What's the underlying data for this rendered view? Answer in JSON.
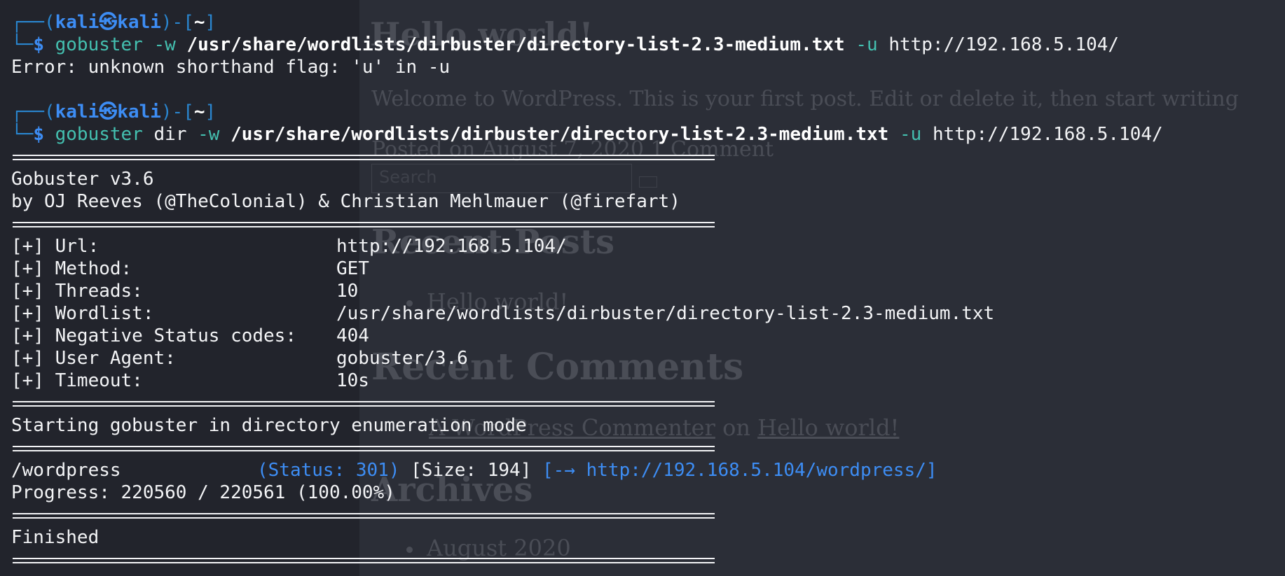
{
  "background_page": {
    "title": "Hello world!",
    "welcome_text": "Welcome to WordPress. This is your first post. Edit or delete it, then start writing",
    "post_meta": "Posted on August 7, 2020 1 Comment",
    "search_placeholder": "Search",
    "recent_posts_heading": "Recent Posts",
    "recent_posts_item": "Hello world!",
    "recent_comments_heading": "Recent Comments",
    "comment_author": "A WordPress Commenter",
    "comment_on": "on",
    "comment_post": "Hello world!",
    "archives_heading": "Archives",
    "archives_item": "August 2020"
  },
  "terminal": {
    "prompt1": {
      "frame_open": "┌──(",
      "user": "kali",
      "at_icon": "㉿",
      "host": "kali",
      "frame_mid": ")-[",
      "dir": "~",
      "frame_close": "]",
      "prefix2": "└─",
      "dollar": "$",
      "cmd": "gobuster",
      "flag_w": "-w",
      "wordlist": "/usr/share/wordlists/dirbuster/directory-list-2.3-medium.txt",
      "flag_u": "-u",
      "url": "http://192.168.5.104/"
    },
    "error_line": "Error: unknown shorthand flag: 'u' in -u",
    "prompt2": {
      "frame_open": "┌──(",
      "user": "kali",
      "at_icon": "㉿",
      "host": "kali",
      "frame_mid": ")-[",
      "dir": "~",
      "frame_close": "]",
      "prefix2": "└─",
      "dollar": "$",
      "cmd": "gobuster",
      "subcmd": "dir",
      "flag_w": "-w",
      "wordlist": "/usr/share/wordlists/dirbuster/directory-list-2.3-medium.txt",
      "flag_u": "-u",
      "url": "http://192.168.5.104/"
    },
    "banner_version": "Gobuster v3.6",
    "banner_authors": "by OJ Reeves (@TheColonial) & Christian Mehlmauer (@firefart)",
    "config": [
      {
        "key": "[+] Url:",
        "value": "http://192.168.5.104/"
      },
      {
        "key": "[+] Method:",
        "value": "GET"
      },
      {
        "key": "[+] Threads:",
        "value": "10"
      },
      {
        "key": "[+] Wordlist:",
        "value": "/usr/share/wordlists/dirbuster/directory-list-2.3-medium.txt"
      },
      {
        "key": "[+] Negative Status codes:",
        "value": "404"
      },
      {
        "key": "[+] User Agent:",
        "value": "gobuster/3.6"
      },
      {
        "key": "[+] Timeout:",
        "value": "10s"
      }
    ],
    "starting_line": "Starting gobuster in directory enumeration mode",
    "result": {
      "path": "/wordpress",
      "status": "(Status: 301)",
      "size": "[Size: 194]",
      "redirect": "[-→ http://192.168.5.104/wordpress/]"
    },
    "progress_line": "Progress: 220560 / 220561 (100.00%)",
    "finished_line": "Finished"
  },
  "colors": {
    "background": "#2b2e37",
    "left_pane": "#22242c",
    "prompt_blue": "#3d8df4",
    "command_teal": "#44c0b0",
    "text": "#f3f4f6"
  }
}
